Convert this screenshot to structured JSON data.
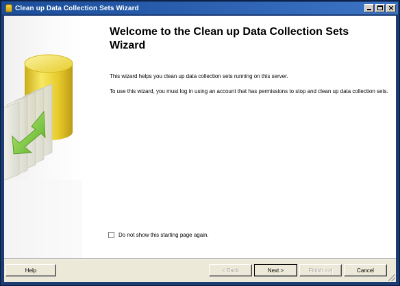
{
  "window": {
    "title": "Clean up Data Collection Sets Wizard",
    "titlebar_color": "#1a4d9a"
  },
  "icons": {
    "title": "database-icon",
    "illustration": "database-documents-arrow-icon"
  },
  "content": {
    "heading": "Welcome to the Clean up Data Collection Sets Wizard",
    "paragraph1": "This wizard helps you clean up data collection sets running on this server.",
    "paragraph2": "To use this wizard, you must log in using an account that has permissions to stop and clean up data collection sets.",
    "checkbox_label": "Do not show this starting page again.",
    "checkbox_checked": false
  },
  "buttons": {
    "help": "Help",
    "back": "< Back",
    "next": "Next >",
    "finish": "Finish >>|",
    "cancel": "Cancel"
  }
}
